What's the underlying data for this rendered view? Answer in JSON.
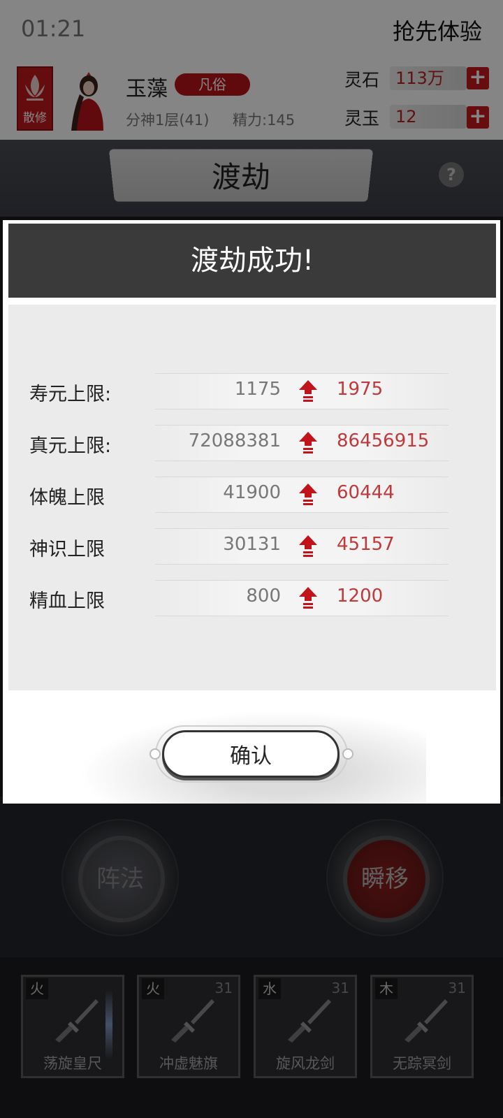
{
  "status_bar": {
    "time": "01:21"
  },
  "header": {
    "promo_label": "抢先体验",
    "sect_label": "散修",
    "player_name": "玉藻",
    "rank_badge": "凡俗",
    "realm": "分神1层(41)",
    "energy": "精力:145",
    "currencies": [
      {
        "label": "灵石",
        "value": "113万"
      },
      {
        "label": "灵玉",
        "value": "12"
      }
    ]
  },
  "scene": {
    "title": "渡劫"
  },
  "dialog": {
    "title": "渡劫成功!",
    "stats": [
      {
        "label": "寿元上限:",
        "old": "1175",
        "new": "1975"
      },
      {
        "label": "真元上限:",
        "old": "72088381",
        "new": "86456915"
      },
      {
        "label": "体魄上限",
        "old": "41900",
        "new": "60444"
      },
      {
        "label": "神识上限",
        "old": "30131",
        "new": "45157"
      },
      {
        "label": "精血上限",
        "old": "800",
        "new": "1200"
      }
    ],
    "confirm_label": "确认"
  },
  "actions": {
    "formation_label": "阵法",
    "teleport_label": "瞬移"
  },
  "skills": [
    {
      "element": "火",
      "level": "",
      "name": "荡旋皇尺"
    },
    {
      "element": "火",
      "level": "31",
      "name": "冲虚魅旗"
    },
    {
      "element": "水",
      "level": "31",
      "name": "旋风龙剑"
    },
    {
      "element": "木",
      "level": "31",
      "name": "无踪冥剑"
    }
  ],
  "colors": {
    "accent_red": "#c81a1e",
    "increase_red": "#c0393b",
    "dialog_header": "#3a3a3b"
  }
}
